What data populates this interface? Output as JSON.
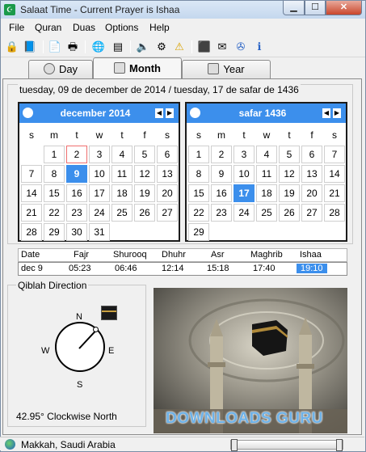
{
  "window": {
    "title": "Salaat Time - Current Prayer is Ishaa"
  },
  "menu": [
    "File",
    "Quran",
    "Duas",
    "Options",
    "Help"
  ],
  "toolbar_icons": [
    "lock-icon",
    "book-icon",
    "document-icon",
    "printer-icon",
    "globe-icon",
    "calculator-icon",
    "speaker-icon",
    "tools-icon",
    "warning-icon",
    "kaaba-icon",
    "card-icon",
    "compass-icon",
    "info-icon"
  ],
  "tabs": [
    {
      "label": "Day",
      "active": false
    },
    {
      "label": "Month",
      "active": true
    },
    {
      "label": "Year",
      "active": false
    }
  ],
  "date_caption": "tuesday, 09 de december de 2014 / tuesday, 17 de safar de 1436",
  "gregorian": {
    "title": "december 2014",
    "dow": [
      "s",
      "m",
      "t",
      "w",
      "t",
      "f",
      "s"
    ],
    "weeks": [
      [
        "",
        "1",
        "2",
        "3",
        "4",
        "5",
        "6"
      ],
      [
        "7",
        "8",
        "9",
        "10",
        "11",
        "12",
        "13"
      ],
      [
        "14",
        "15",
        "16",
        "17",
        "18",
        "19",
        "20"
      ],
      [
        "21",
        "22",
        "23",
        "24",
        "25",
        "26",
        "27"
      ],
      [
        "28",
        "29",
        "30",
        "31",
        "",
        "",
        ""
      ]
    ],
    "today": "9"
  },
  "hijri": {
    "title": "safar 1436",
    "dow": [
      "s",
      "m",
      "t",
      "w",
      "t",
      "f",
      "s"
    ],
    "weeks": [
      [
        "1",
        "2",
        "3",
        "4",
        "5",
        "6",
        "7"
      ],
      [
        "8",
        "9",
        "10",
        "11",
        "12",
        "13",
        "14"
      ],
      [
        "15",
        "16",
        "17",
        "18",
        "19",
        "20",
        "21"
      ],
      [
        "22",
        "23",
        "24",
        "25",
        "26",
        "27",
        "28"
      ],
      [
        "29",
        "",
        "",
        "",
        "",
        "",
        ""
      ]
    ],
    "today": "17"
  },
  "prayer_table": {
    "headers": [
      "Date",
      "Fajr",
      "Shurooq",
      "Dhuhr",
      "Asr",
      "Maghrib",
      "Ishaa"
    ],
    "row": [
      "dec 9",
      "05:23",
      "06:46",
      "12:14",
      "15:18",
      "17:40",
      "19:10"
    ],
    "current": "Ishaa"
  },
  "qibla": {
    "caption": "Qiblah Direction",
    "directions": {
      "n": "N",
      "s": "S",
      "e": "E",
      "w": "W"
    },
    "degrees": 42.95,
    "text": "42.95° Clockwise North"
  },
  "watermark": "DOWNLOADS GURU",
  "status": {
    "location": "Makkah, Saudi Arabia"
  },
  "colors": {
    "accent": "#3c8fec",
    "titlebar": "#c4d7ee"
  }
}
